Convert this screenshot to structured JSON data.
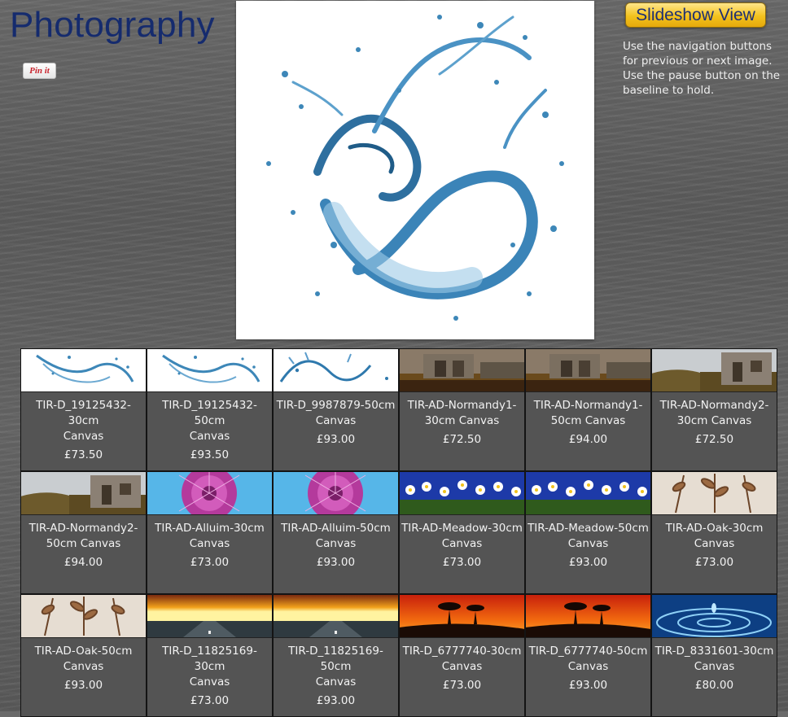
{
  "page": {
    "title": "Photography",
    "pin_label": "Pin it"
  },
  "slideshow": {
    "button_label": "Slideshow View",
    "instructions": "Use the navigation buttons for previous or next image. Use the pause button on the baseline to hold."
  },
  "hero": {
    "image": "water-splash"
  },
  "products": [
    {
      "name": "TIR-D_19125432-30cm\nCanvas",
      "price": "£73.50",
      "image": "water-splash"
    },
    {
      "name": "TIR-D_19125432-50cm\nCanvas",
      "price": "£93.50",
      "image": "water-splash"
    },
    {
      "name": "TIR-D_9987879-50cm\nCanvas",
      "price": "£93.00",
      "image": "water-splash-2"
    },
    {
      "name": "TIR-AD-Normandy1-\n30cm Canvas",
      "price": "£72.50",
      "image": "normandy-barn"
    },
    {
      "name": "TIR-AD-Normandy1-\n50cm Canvas",
      "price": "£94.00",
      "image": "normandy-barn"
    },
    {
      "name": "TIR-AD-Normandy2-\n30cm Canvas",
      "price": "£72.50",
      "image": "normandy-barn-2"
    },
    {
      "name": "TIR-AD-Normandy2-\n50cm Canvas",
      "price": "£94.00",
      "image": "normandy-barn-2"
    },
    {
      "name": "TIR-AD-Alluim-30cm\nCanvas",
      "price": "£73.00",
      "image": "allium-flower"
    },
    {
      "name": "TIR-AD-Alluim-50cm\nCanvas",
      "price": "£93.00",
      "image": "allium-flower"
    },
    {
      "name": "TIR-AD-Meadow-30cm\nCanvas",
      "price": "£73.00",
      "image": "daisy-meadow"
    },
    {
      "name": "TIR-AD-Meadow-50cm\nCanvas",
      "price": "£93.00",
      "image": "daisy-meadow"
    },
    {
      "name": "TIR-AD-Oak-30cm\nCanvas",
      "price": "£73.00",
      "image": "oak-leaves"
    },
    {
      "name": "TIR-AD-Oak-50cm\nCanvas",
      "price": "£93.00",
      "image": "oak-leaves"
    },
    {
      "name": "TIR-D_11825169-30cm\nCanvas",
      "price": "£73.00",
      "image": "sunset-road"
    },
    {
      "name": "TIR-D_11825169-50cm\nCanvas",
      "price": "£93.00",
      "image": "sunset-road"
    },
    {
      "name": "TIR-D_6777740-30cm\nCanvas",
      "price": "£73.00",
      "image": "red-sunset-trees"
    },
    {
      "name": "TIR-D_6777740-50cm\nCanvas",
      "price": "£93.00",
      "image": "red-sunset-trees"
    },
    {
      "name": "TIR-D_8331601-30cm\nCanvas",
      "price": "£80.00",
      "image": "water-ripple"
    }
  ]
}
